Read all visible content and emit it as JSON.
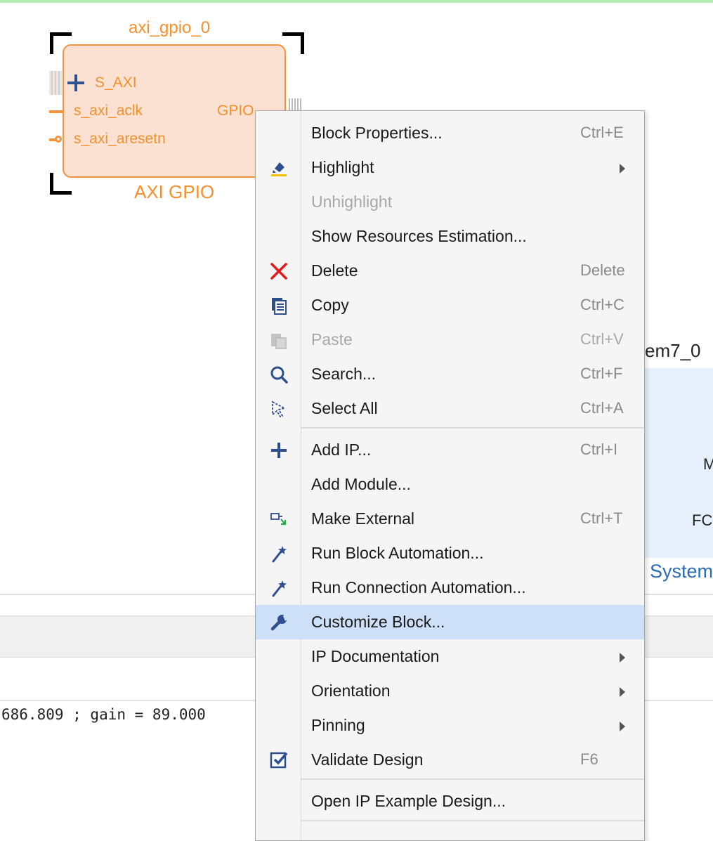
{
  "canvas": {
    "block": {
      "instance_name": "axi_gpio_0",
      "type_name": "AXI GPIO",
      "ports_left": [
        "S_AXI",
        "s_axi_aclk",
        "s_axi_aresetn"
      ],
      "port_right": "GPIO"
    },
    "ps_block": {
      "title_partial": "em7_0",
      "label_m": "M",
      "label_fc": "FC",
      "label_system": "System"
    }
  },
  "console": {
    "line": "686.809 ; gain = 89.000"
  },
  "menu": {
    "highlight_color": "#cde0f7",
    "items": [
      {
        "label": "Block Properties...",
        "shortcut": "Ctrl+E",
        "icon": "none"
      },
      {
        "label": "Highlight",
        "shortcut": "",
        "icon": "highlight-icon",
        "submenu": true
      },
      {
        "label": "Unhighlight",
        "shortcut": "",
        "icon": "none",
        "disabled": true
      },
      {
        "label": "Show Resources Estimation...",
        "shortcut": "",
        "icon": "none"
      },
      {
        "label": "Delete",
        "shortcut": "Delete",
        "icon": "delete-x-icon"
      },
      {
        "label": "Copy",
        "shortcut": "Ctrl+C",
        "icon": "copy-icon"
      },
      {
        "label": "Paste",
        "shortcut": "Ctrl+V",
        "icon": "paste-icon",
        "disabled": true
      },
      {
        "label": "Search...",
        "shortcut": "Ctrl+F",
        "icon": "search-icon"
      },
      {
        "label": "Select All",
        "shortcut": "Ctrl+A",
        "icon": "select-all-icon"
      },
      {
        "label": "Add IP...",
        "shortcut": "Ctrl+I",
        "icon": "plus-icon"
      },
      {
        "label": "Add Module...",
        "shortcut": "",
        "icon": "none"
      },
      {
        "label": "Make External",
        "shortcut": "Ctrl+T",
        "icon": "make-external-icon"
      },
      {
        "label": "Run Block Automation...",
        "shortcut": "",
        "icon": "wand-icon"
      },
      {
        "label": "Run Connection Automation...",
        "shortcut": "",
        "icon": "wand-icon"
      },
      {
        "label": "Customize Block...",
        "shortcut": "",
        "icon": "wrench-icon",
        "highlighted": true
      },
      {
        "label": "IP Documentation",
        "shortcut": "",
        "icon": "none",
        "submenu": true
      },
      {
        "label": "Orientation",
        "shortcut": "",
        "icon": "none",
        "submenu": true
      },
      {
        "label": "Pinning",
        "shortcut": "",
        "icon": "none",
        "submenu": true
      },
      {
        "label": "Validate Design",
        "shortcut": "F6",
        "icon": "validate-check-icon"
      },
      {
        "label": "Open IP Example Design...",
        "shortcut": "",
        "icon": "none"
      }
    ]
  }
}
